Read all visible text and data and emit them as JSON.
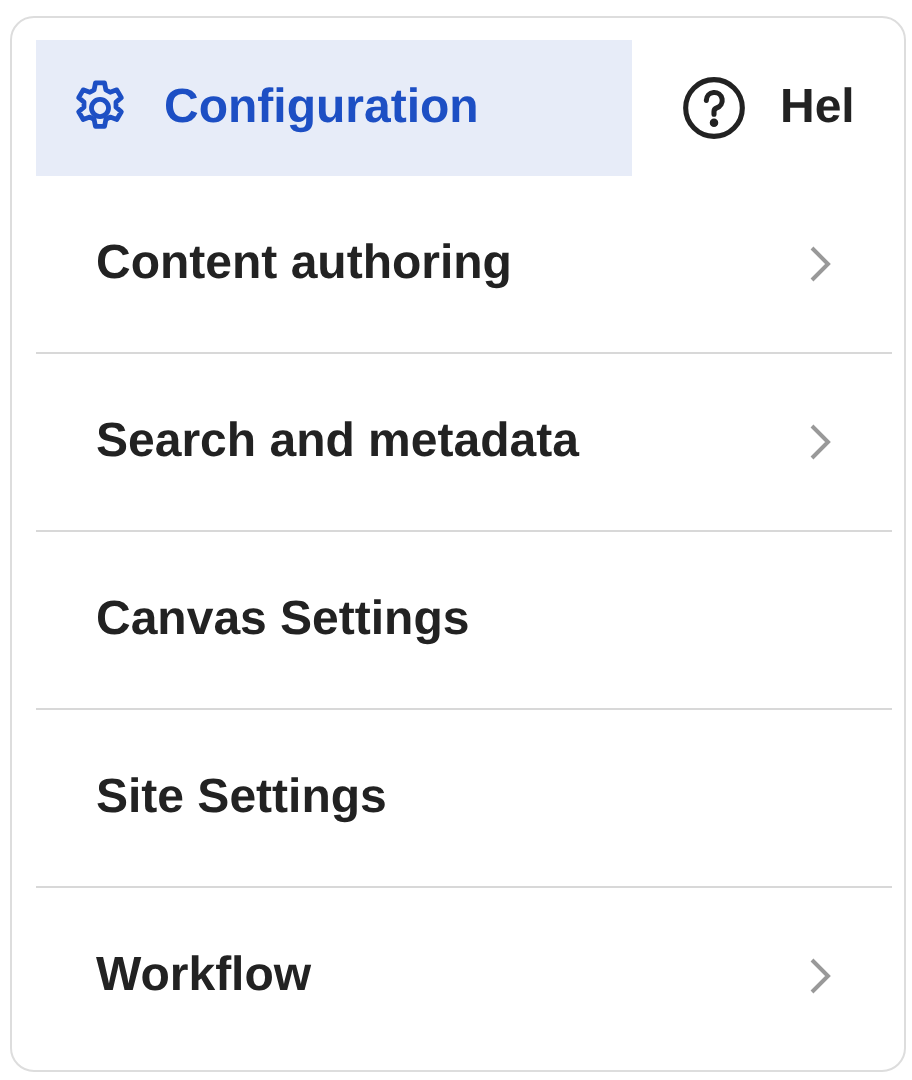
{
  "tabs": [
    {
      "kind": "settings",
      "label": "Configuration",
      "selected": true
    },
    {
      "kind": "help",
      "label": "Hel",
      "selected": false
    }
  ],
  "menu": {
    "items": [
      {
        "label": "Content authoring",
        "has_submenu": true
      },
      {
        "label": "Search and metadata",
        "has_submenu": true
      },
      {
        "label": "Canvas Settings",
        "has_submenu": false
      },
      {
        "label": "Site Settings",
        "has_submenu": false
      },
      {
        "label": "Workflow",
        "has_submenu": true
      }
    ]
  }
}
